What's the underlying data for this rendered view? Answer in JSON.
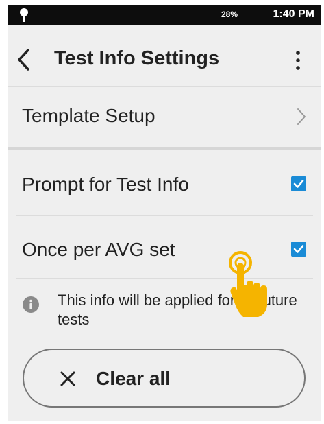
{
  "status_bar": {
    "battery": "28%",
    "time": "1:40 PM"
  },
  "header": {
    "title": "Test Info Settings"
  },
  "rows": [
    {
      "label": "Template Setup"
    },
    {
      "label": "Prompt for Test Info",
      "checked": true
    },
    {
      "label": "Once per AVG set",
      "checked": true
    }
  ],
  "info": {
    "text": "This info will be applied for all future tests"
  },
  "clear_button": {
    "label": "Clear all"
  },
  "colors": {
    "checkbox": "#1a8bd6",
    "pointer_hand": "#f5b400",
    "status_bar": "#0d0d0d"
  }
}
